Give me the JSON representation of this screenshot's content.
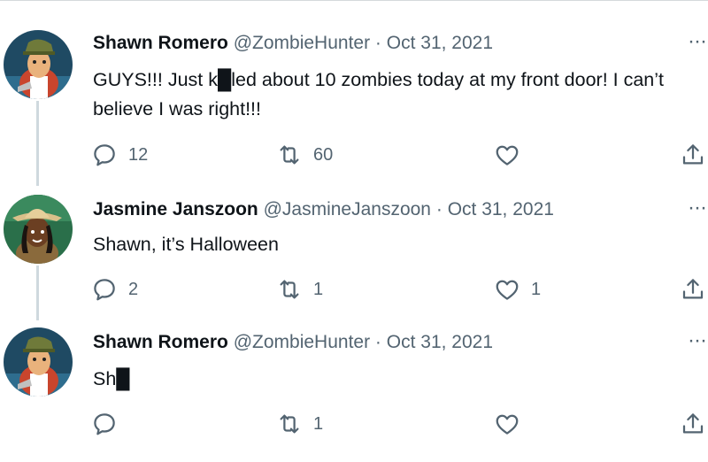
{
  "tweets": [
    {
      "name": "Shawn Romero",
      "handle": "@ZombieHunter",
      "separator": "·",
      "date": "Oct 31, 2021",
      "more": "···",
      "text": "GUYS!!! Just k█led about 10 zombies today at my front door! I can’t believe I was right!!!",
      "replies": "12",
      "retweets": "60",
      "likes": ""
    },
    {
      "name": "Jasmine Janszoon",
      "handle": "@JasmineJanszoon",
      "separator": "·",
      "date": "Oct 31, 2021",
      "more": "···",
      "text": "Shawn, it’s Halloween",
      "replies": "2",
      "retweets": "1",
      "likes": "1"
    },
    {
      "name": "Shawn Romero",
      "handle": "@ZombieHunter",
      "separator": "·",
      "date": "Oct 31, 2021",
      "more": "···",
      "text": "Sh█",
      "replies": "",
      "retweets": "1",
      "likes": ""
    }
  ],
  "colors": {
    "text": "#0f1419",
    "secondary": "#536471",
    "thread_line": "#cfd9de",
    "icon": "#536471"
  },
  "icons": [
    "reply-icon",
    "retweet-icon",
    "like-icon",
    "share-icon",
    "more-icon"
  ]
}
